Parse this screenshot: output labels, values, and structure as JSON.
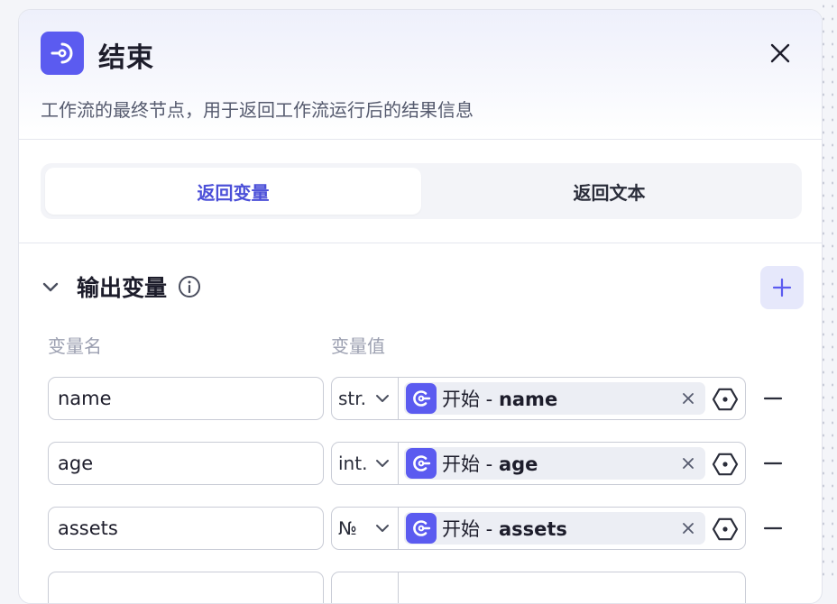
{
  "node": {
    "title": "结束",
    "description": "工作流的最终节点，用于返回工作流运行后的结果信息",
    "icon": "end-node-icon",
    "accent": "#5b5bf0"
  },
  "tabs": [
    {
      "label": "返回变量",
      "active": true
    },
    {
      "label": "返回文本",
      "active": false
    }
  ],
  "output_section": {
    "title": "输出变量",
    "col_name": "变量名",
    "col_value": "变量值",
    "rows": [
      {
        "name": "name",
        "type": "str.",
        "ref_prefix": "开始 - ",
        "ref_var": "name"
      },
      {
        "name": "age",
        "type": "int.",
        "ref_prefix": "开始 - ",
        "ref_var": "age"
      },
      {
        "name": "assets",
        "type": "№",
        "ref_prefix": "开始 - ",
        "ref_var": "assets"
      },
      {
        "name": "",
        "type": "",
        "ref_prefix": "",
        "ref_var": ""
      }
    ]
  }
}
